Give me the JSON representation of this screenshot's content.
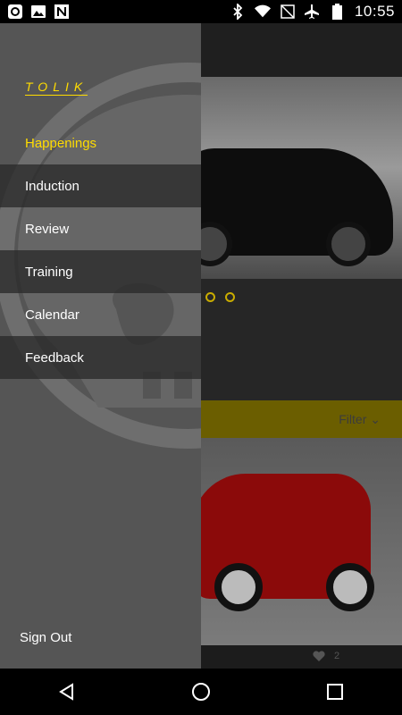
{
  "status_bar": {
    "time": "10:55",
    "left_icons": [
      "circle-notification-icon",
      "image-icon",
      "n-logo-icon"
    ],
    "right_icons": [
      "bluetooth-icon",
      "wifi-icon",
      "no-signal-icon",
      "airplane-icon",
      "battery-icon"
    ]
  },
  "drawer": {
    "brand": "TOLIK",
    "menu": [
      {
        "label": "Happenings",
        "active": true
      },
      {
        "label": "Induction",
        "active": false
      },
      {
        "label": "Review",
        "active": false
      },
      {
        "label": "Training",
        "active": false
      },
      {
        "label": "Calendar",
        "active": false
      },
      {
        "label": "Feedback",
        "active": false
      }
    ],
    "sign_out": "Sign Out"
  },
  "background": {
    "filter_label": "Filter",
    "like_count": "2"
  },
  "nav_bar": {
    "buttons": [
      "back-icon",
      "home-icon",
      "recents-icon"
    ]
  },
  "colors": {
    "accent": "#ffdc00",
    "drawer_bg": "#555555",
    "drawer_dark_row": "#3a3a3a"
  }
}
